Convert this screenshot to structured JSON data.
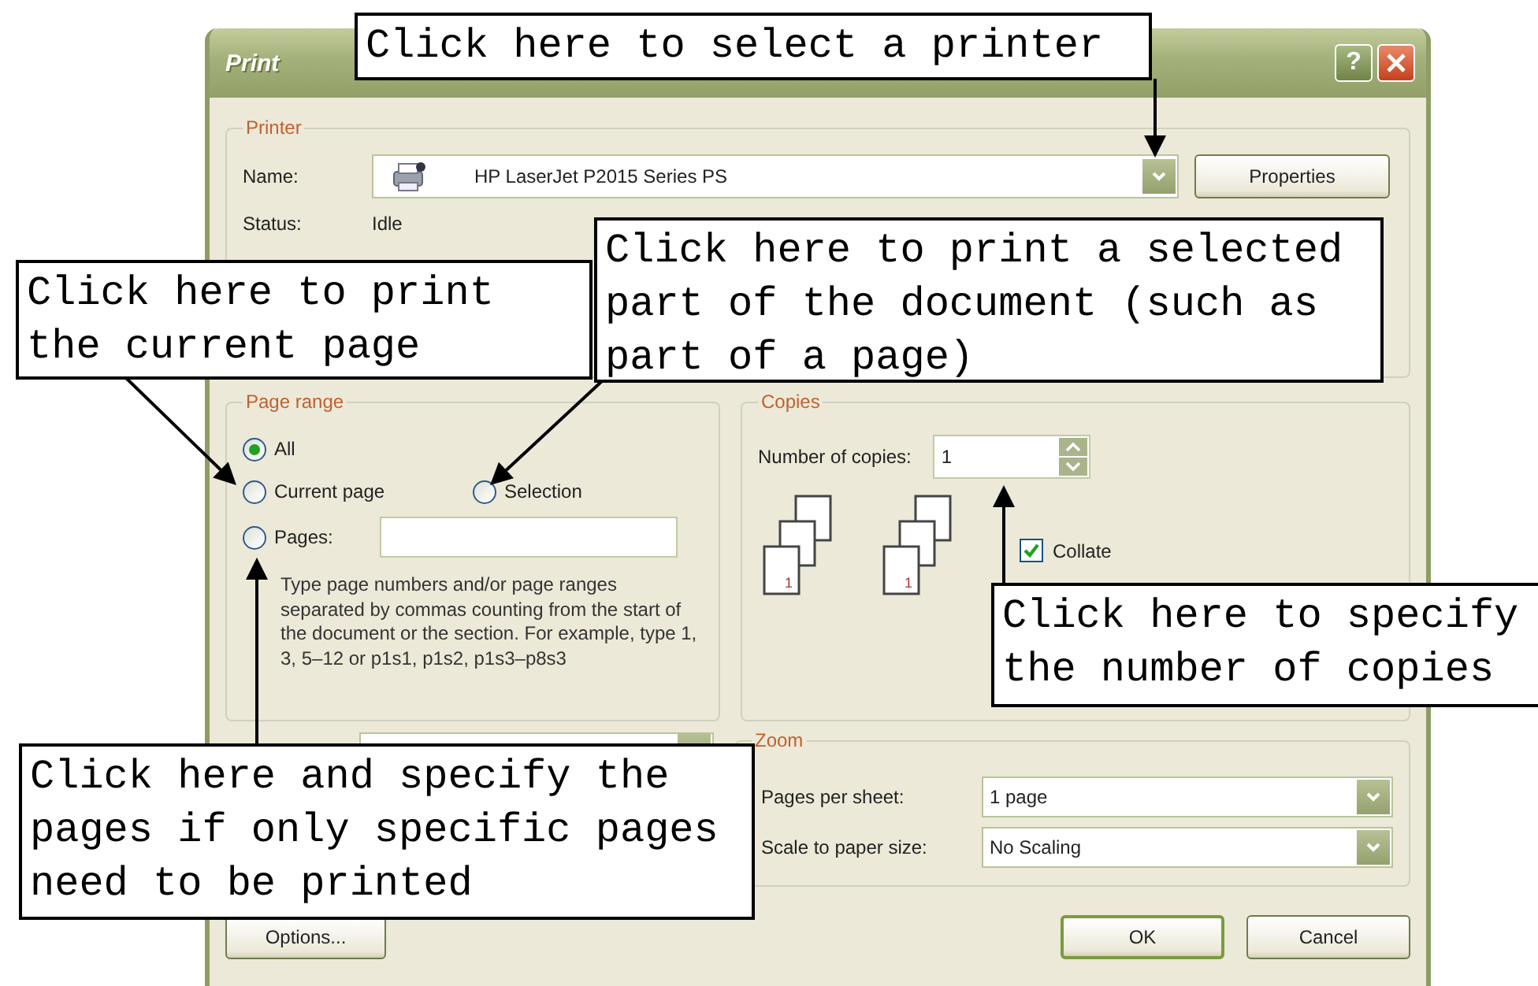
{
  "window": {
    "title": "Print",
    "help_button": "?"
  },
  "printer": {
    "title": "Printer",
    "name_label": "Name:",
    "name_value": "HP LaserJet P2015 Series PS",
    "properties_button": "Properties",
    "status_label": "Status:",
    "status_value": "Idle"
  },
  "page_range": {
    "title": "Page range",
    "options": [
      {
        "label": "All",
        "selected": true
      },
      {
        "label": "Current page",
        "selected": false
      },
      {
        "label": "Selection",
        "selected": false
      },
      {
        "label": "Pages:",
        "selected": false
      }
    ],
    "hint": "Type page numbers and/or page ranges separated by commas counting from the start of the document or the section. For example, type 1, 3, 5–12 or p1s1, p1s2, p1s3–p8s3"
  },
  "copies": {
    "title": "Copies",
    "number_label": "Number of copies:",
    "number_value": "1",
    "page_stacks": [
      {
        "number": "1"
      },
      {
        "number": "1"
      }
    ],
    "collate": {
      "label": "Collate",
      "checked": true
    }
  },
  "zoom": {
    "title": "Zoom",
    "rows": [
      {
        "label": "Pages per sheet:",
        "value": "1 page"
      },
      {
        "label": "Scale to paper size:",
        "value": "No Scaling"
      }
    ]
  },
  "buttons": [
    {
      "label": "Options...",
      "kind": "left"
    },
    {
      "label": "OK",
      "kind": "default"
    },
    {
      "label": "Cancel",
      "kind": "normal"
    }
  ],
  "callouts": [
    {
      "text": "Click here to select a printer"
    },
    {
      "text": "Click here to print the current page"
    },
    {
      "text": "Click here to print a selected part of the document (such as part of a page)"
    },
    {
      "text": "Click here to specify the number of copies"
    },
    {
      "text": "Click here and specify the pages if only specific pages need to be printed"
    }
  ]
}
